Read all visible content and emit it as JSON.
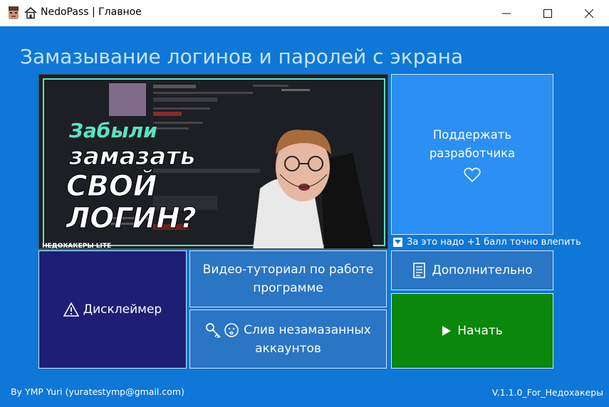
{
  "window": {
    "title": "NedoPass | Главное",
    "minimize_icon": "minimize-icon",
    "maximize_icon": "maximize-icon",
    "close_icon": "close-icon"
  },
  "main": {
    "heading": "Замазывание логинов и паролей с экрана",
    "preview": {
      "overlay_line1": "Забыли",
      "overlay_line2": "замазать",
      "overlay_line3": "СВОЙ",
      "overlay_line4": "ЛОГИН?",
      "channel": "НЕДОХАКЕРЫ LITE"
    },
    "support_button": {
      "label_line1": "Поддержать",
      "label_line2": "разработчика",
      "icon": "heart-icon"
    },
    "note": "За это надо +1 балл точно влепить",
    "disclaimer_button": {
      "label": "Дисклеймер",
      "icon": "warning-icon"
    },
    "video_button": {
      "label_line1": "Видео-туториал по работе",
      "label_line2": "программе"
    },
    "leak_button": {
      "label_line1": "Слив незамазанных",
      "label_line2": "аккаунтов",
      "icons": [
        "key-icon",
        "face-icon"
      ]
    },
    "extra_button": {
      "label": "Дополнительно",
      "icon": "document-icon"
    },
    "start_button": {
      "label": "Начать",
      "icon": "play-icon"
    }
  },
  "footer": {
    "author": "By YMP Yuri (yuratestymp@gmail.com)",
    "version": "V.1.1.0_For_Недохакеры"
  },
  "colors": {
    "background": "#0f77d7",
    "support": "#2b8ff3",
    "disclaimer": "#1e1e75",
    "secondary": "#2a75c4",
    "start": "#0b870b"
  }
}
